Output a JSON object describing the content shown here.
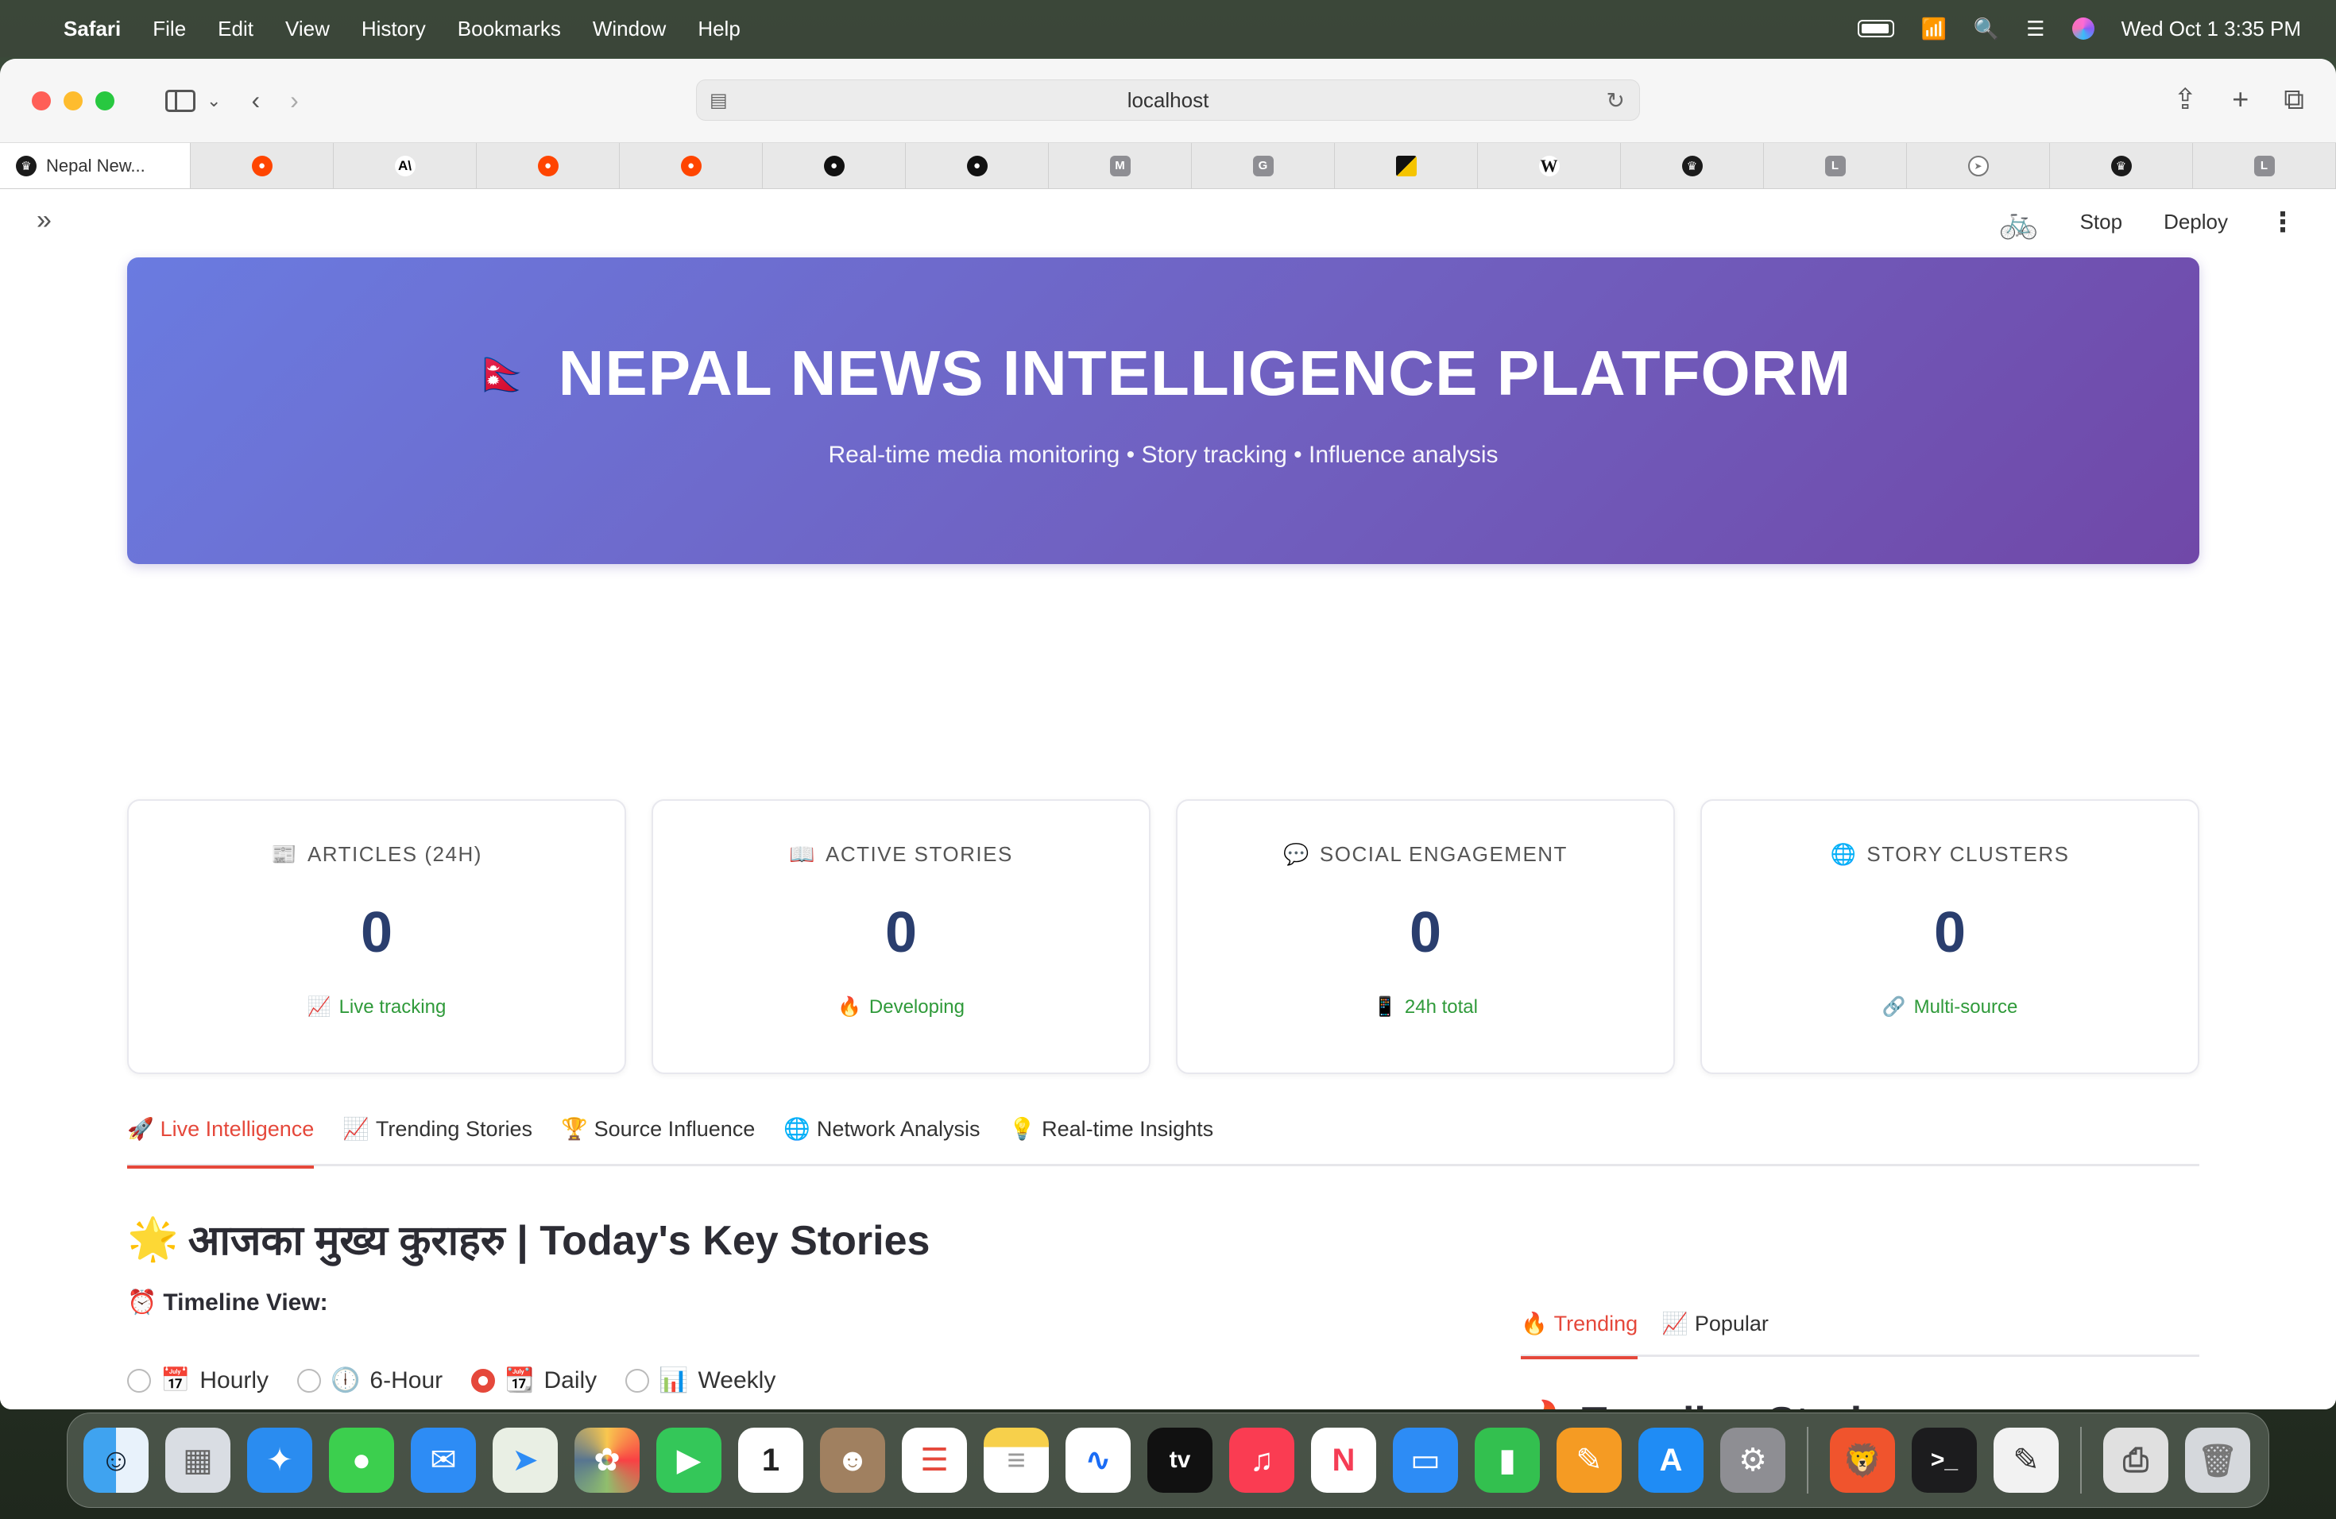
{
  "menubar": {
    "app": "Safari",
    "items": [
      "File",
      "Edit",
      "View",
      "History",
      "Bookmarks",
      "Window",
      "Help"
    ],
    "datetime": "Wed Oct 1  3:35 PM"
  },
  "browser": {
    "url": "localhost",
    "active_tab_title": "Nepal New...",
    "tab_icons": [
      "reddit",
      "anthropic",
      "reddit",
      "reddit",
      "github",
      "github",
      "M",
      "G",
      "flag",
      "W",
      "crown",
      "L",
      "compass",
      "crown",
      "L"
    ]
  },
  "app_header": {
    "stop": "Stop",
    "deploy": "Deploy"
  },
  "hero": {
    "flag": "🇳🇵",
    "title": "NEPAL NEWS INTELLIGENCE PLATFORM",
    "subtitle": "Real-time media monitoring • Story tracking • Influence analysis"
  },
  "metrics": [
    {
      "icon": "📰",
      "label": "ARTICLES (24H)",
      "value": "0",
      "note_icon": "📈",
      "note": "Live tracking"
    },
    {
      "icon": "📖",
      "label": "ACTIVE STORIES",
      "value": "0",
      "note_icon": "🔥",
      "note": "Developing"
    },
    {
      "icon": "💬",
      "label": "SOCIAL ENGAGEMENT",
      "value": "0",
      "note_icon": "📱",
      "note": "24h total"
    },
    {
      "icon": "🌐",
      "label": "STORY CLUSTERS",
      "value": "0",
      "note_icon": "🔗",
      "note": "Multi-source"
    }
  ],
  "main_tabs": [
    {
      "icon": "🚀",
      "label": "Live Intelligence"
    },
    {
      "icon": "📈",
      "label": "Trending Stories"
    },
    {
      "icon": "🏆",
      "label": "Source Influence"
    },
    {
      "icon": "🌐",
      "label": "Network Analysis"
    },
    {
      "icon": "💡",
      "label": "Real-time Insights"
    }
  ],
  "key_stories": {
    "icon": "🌟",
    "title": "आजका मुख्य कुराहरु | Today's Key Stories"
  },
  "timeline": {
    "icon": "⏰",
    "label": "Timeline View:",
    "options": [
      {
        "icon": "📅",
        "label": "Hourly"
      },
      {
        "icon": "🕕",
        "label": "6-Hour"
      },
      {
        "icon": "📆",
        "label": "Daily"
      },
      {
        "icon": "📊",
        "label": "Weekly"
      }
    ],
    "selected": "Daily"
  },
  "side_tabs": [
    {
      "icon": "🔥",
      "label": "Trending"
    },
    {
      "icon": "📈",
      "label": "Popular"
    }
  ],
  "trending": {
    "icon": "🔥",
    "title": "Trending Stories"
  },
  "colors": {
    "accent": "#e5483b",
    "metric_value": "#2a3e6e",
    "note_green": "#2f9a3a",
    "hero_start": "#6a7be0",
    "hero_end": "#7048a8"
  }
}
